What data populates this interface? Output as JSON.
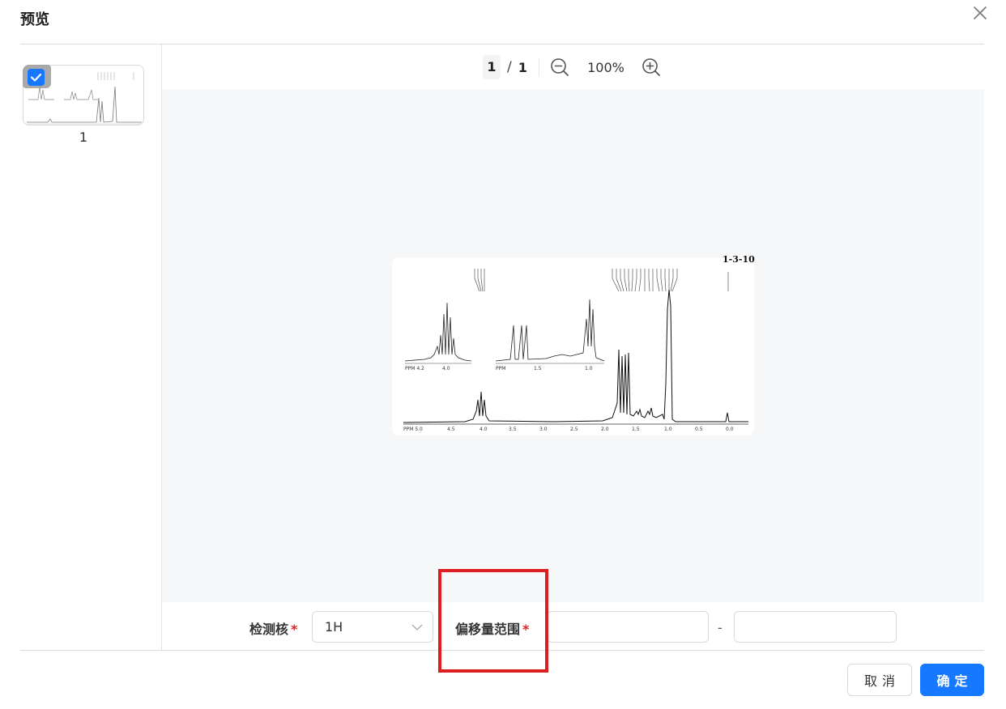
{
  "dialog": {
    "title": "预览"
  },
  "thumbnails": [
    {
      "label": "1",
      "selected": true
    }
  ],
  "toolbar": {
    "current_page": "1",
    "separator": "/",
    "total_pages": "1",
    "zoom": "100%"
  },
  "preview": {
    "spectrum_id": "1-3-10"
  },
  "form": {
    "nucleus_label": "检测核",
    "nucleus_value": "1H",
    "required_mark": "*",
    "shift_range_label": "偏移量范围",
    "range_separator": "-",
    "shift_min": "",
    "shift_max": ""
  },
  "buttons": {
    "cancel": "取消",
    "confirm": "确定"
  },
  "colors": {
    "primary": "#1677ff",
    "required": "#e02020",
    "highlight": "#dc1e1e",
    "preview_bg": "#f6f7f9"
  },
  "icons": {
    "close": "close-icon",
    "zoom_out": "zoom-out-icon",
    "zoom_in": "zoom-in-icon",
    "dropdown": "chevron-down-icon",
    "check": "check-icon"
  }
}
